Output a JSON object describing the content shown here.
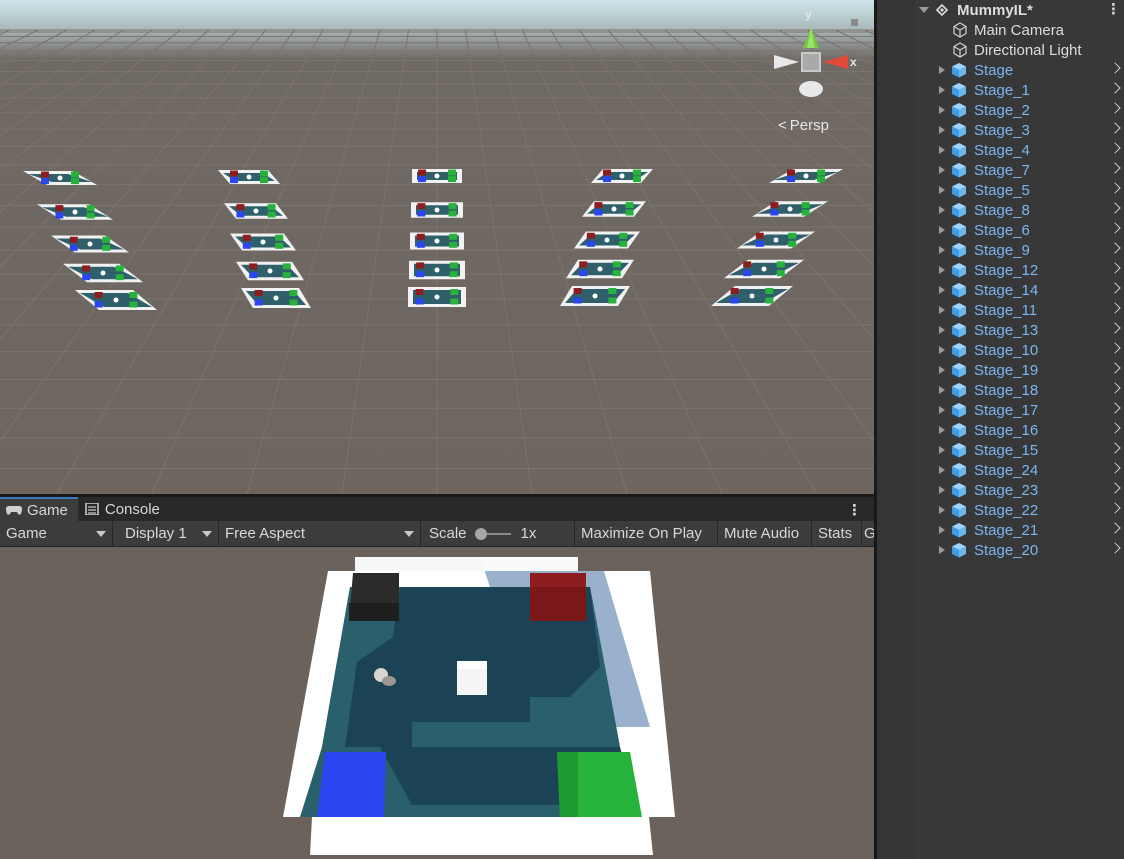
{
  "scene": {
    "projection_label": "Persp",
    "projection_icon": "perspective-icon",
    "gizmo_axes": {
      "y": "y",
      "x": "x"
    }
  },
  "game_panel": {
    "tabs": [
      {
        "label": "Game",
        "icon": "gamepad-icon",
        "active": true
      },
      {
        "label": "Console",
        "icon": "console-icon",
        "active": false
      }
    ],
    "menu_icon": "kebab-menu-icon",
    "toolbar": {
      "view_select": "Game",
      "display_select": "Display 1",
      "aspect_select": "Free Aspect",
      "scale_label": "Scale",
      "scale_value": "1x",
      "maximize_on_play": "Maximize On Play",
      "mute_audio": "Mute Audio",
      "stats": "Stats",
      "gizmos_truncated": "G"
    }
  },
  "hierarchy": {
    "scene_name": "MummyIL*",
    "children": [
      {
        "label": "Main Camera",
        "type": "gameobject",
        "color": "#dcdcdc"
      },
      {
        "label": "Directional Light",
        "type": "gameobject",
        "color": "#dcdcdc"
      }
    ],
    "prefabs": [
      "Stage",
      "Stage_1",
      "Stage_2",
      "Stage_3",
      "Stage_4",
      "Stage_7",
      "Stage_5",
      "Stage_8",
      "Stage_6",
      "Stage_9",
      "Stage_12",
      "Stage_14",
      "Stage_11",
      "Stage_13",
      "Stage_10",
      "Stage_19",
      "Stage_18",
      "Stage_17",
      "Stage_16",
      "Stage_15",
      "Stage_24",
      "Stage_23",
      "Stage_22",
      "Stage_21",
      "Stage_20"
    ],
    "prefab_color": "#7cb6f2"
  },
  "colors": {
    "accent_tab": "#3a79bb",
    "corner_black": "#2b2b2b",
    "corner_red": "#8e1d1f",
    "corner_blue": "#2a46f0",
    "corner_green": "#27b23b",
    "floor": "#2f5f6b"
  }
}
